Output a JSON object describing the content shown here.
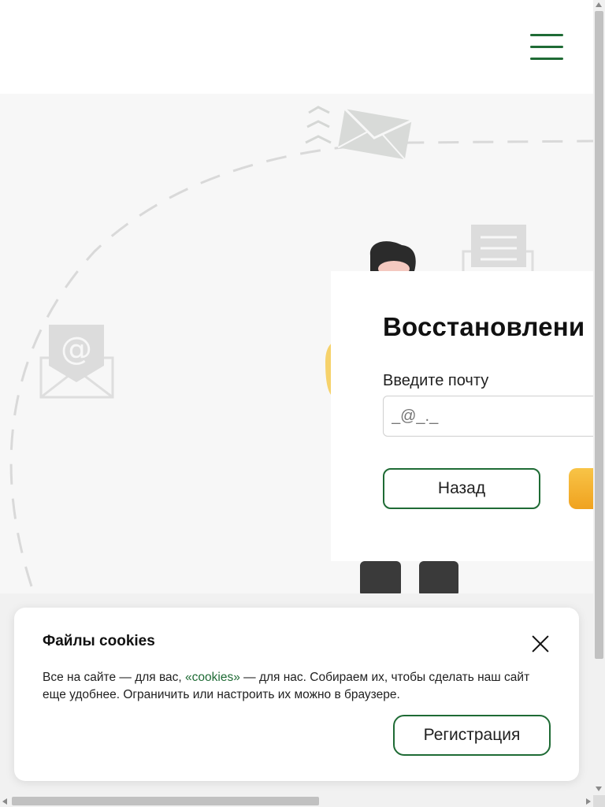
{
  "header": {
    "menu_icon": "hamburger-menu-icon"
  },
  "colors": {
    "brand_green": "#1f6b35",
    "accent_orange": "#f0a21f",
    "hero_background": "#f7f7f7"
  },
  "hero": {
    "decorations": [
      "envelope-icon",
      "at-sign-envelope-icon",
      "letter-envelope-icon",
      "person-illustration"
    ]
  },
  "recovery_form": {
    "title": "Восстановлени",
    "email_label": "Введите почту",
    "email_placeholder": "_@_._",
    "back_button_label": "Назад"
  },
  "cookie_banner": {
    "title": "Файлы cookies",
    "text_before_link": "Все на сайте — для вас, ",
    "link_text": "«cookies»",
    "text_after_link": " — для нас. Собираем их, чтобы сделать наш сайт еще удобнее. Ограничить или настроить их можно в браузере.",
    "button_label": "Регистрация",
    "close_icon": "close-icon"
  }
}
